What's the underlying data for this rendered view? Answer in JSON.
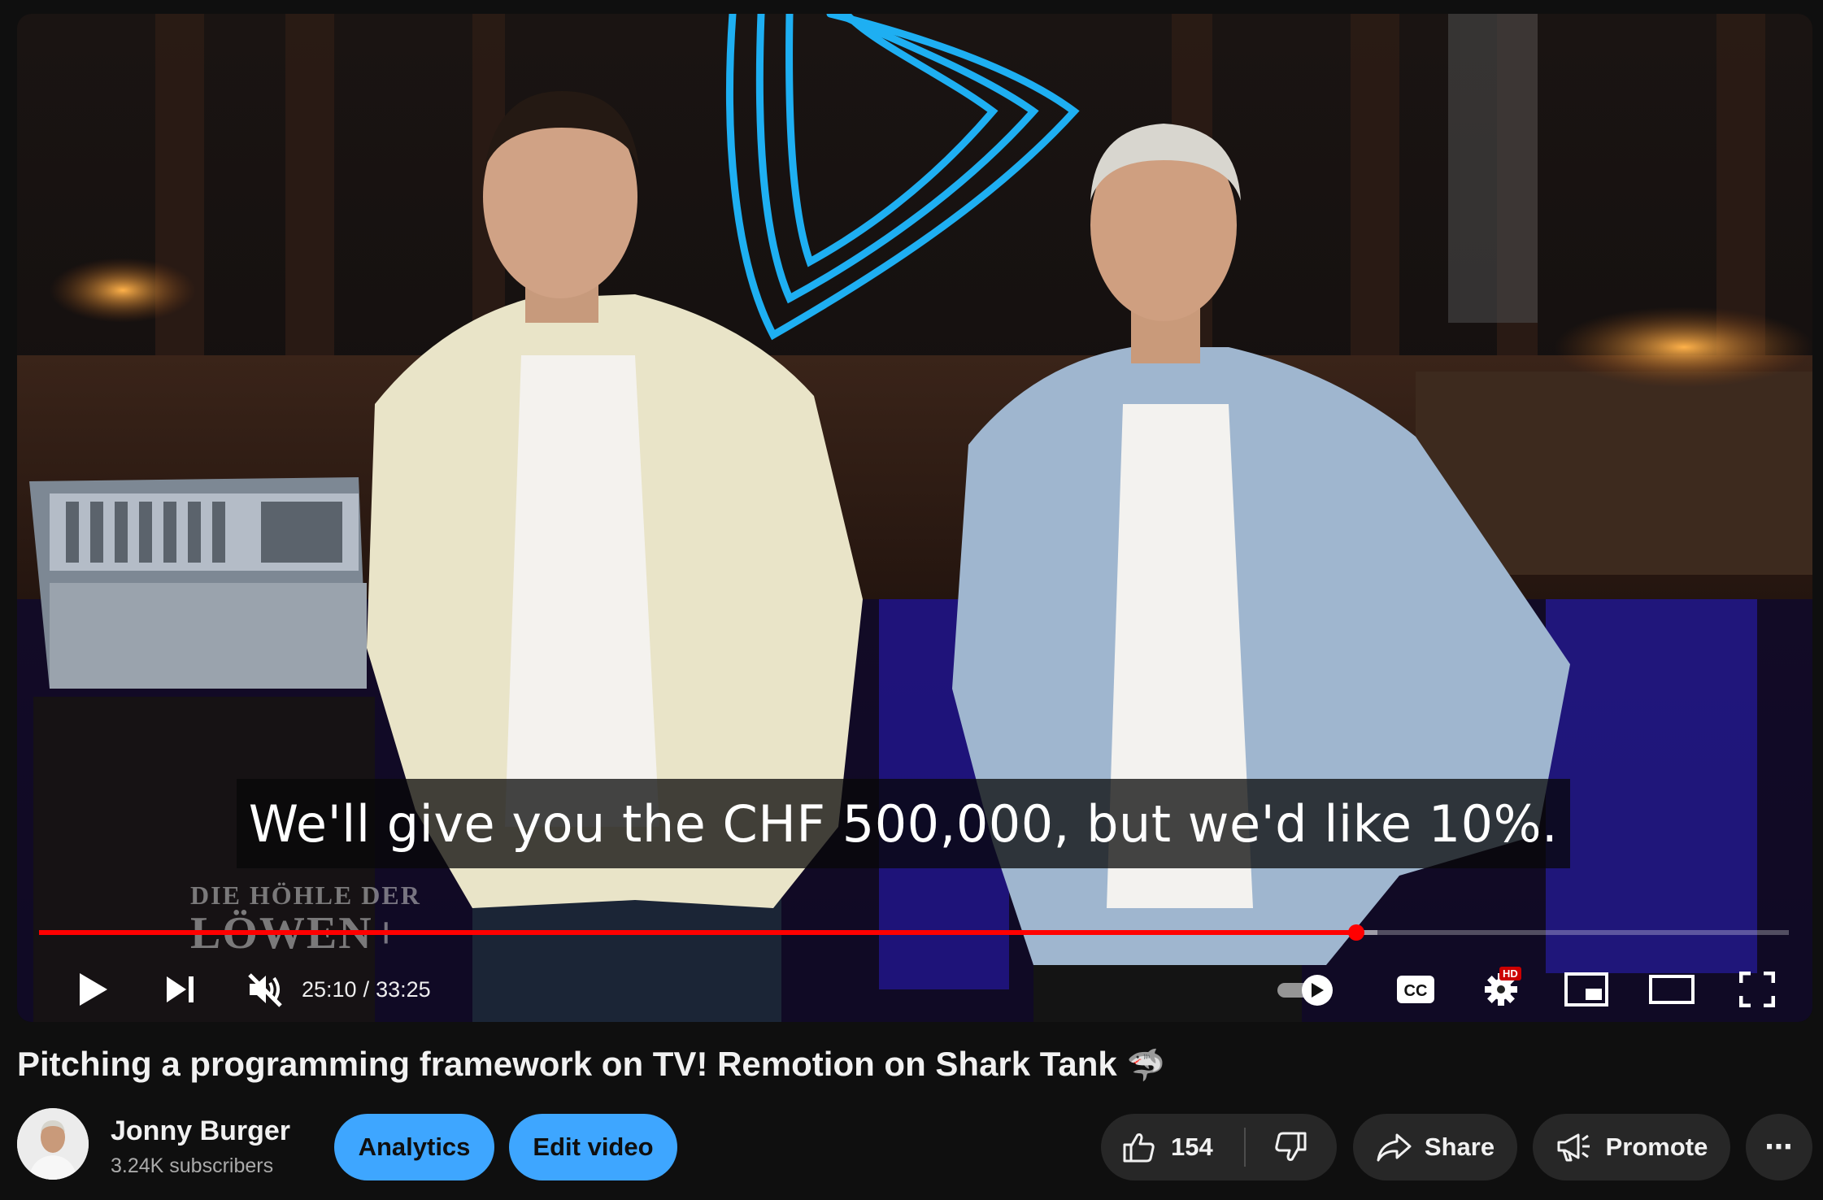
{
  "player": {
    "caption": "We'll give you the CHF 500,000, but we'd like 10%.",
    "watermark": {
      "line1": "DIE HÖHLE DER",
      "line2": "LÖWEN+"
    },
    "current_time": "25:10",
    "duration": "33:25",
    "time_separator": "/",
    "progress_fraction": 0.753,
    "buffered_fraction": 0.765,
    "muted": true,
    "quality_badge": "HD",
    "cc_label": "CC",
    "autoplay_on": true,
    "accent_color": "#ff0000"
  },
  "controls_icons": [
    "play-icon",
    "next-icon",
    "volume-muted-icon",
    "autoplay-toggle",
    "captions-icon",
    "settings-icon",
    "miniplayer-icon",
    "theater-mode-icon",
    "fullscreen-icon"
  ],
  "video": {
    "title": "Pitching a programming framework on TV! Remotion on Shark Tank",
    "title_emoji": "🦈"
  },
  "channel": {
    "name": "Jonny Burger",
    "subscribers": "3.24K subscribers"
  },
  "actions": {
    "analytics": "Analytics",
    "edit_video": "Edit video",
    "like_count": "154",
    "share": "Share",
    "promote": "Promote",
    "more": "⋯"
  },
  "colors": {
    "background": "#0f0f0f",
    "primary_button": "#3ea6ff",
    "secondary_button": "#272727",
    "progress": "#ff0000"
  }
}
